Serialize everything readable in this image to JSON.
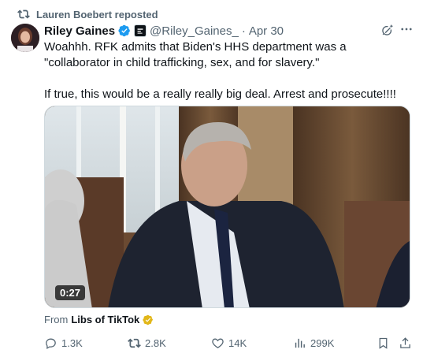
{
  "repost": {
    "label": "Lauren Boebert reposted"
  },
  "author": {
    "name": "Riley Gaines",
    "handle": "@Riley_Gaines_",
    "separator": "·",
    "date": "Apr 30"
  },
  "tweet": {
    "line1": "Woahhh. RFK admits that Biden's HHS department was a \"collaborator in child trafficking, sex, and for slavery.\"",
    "line2": "If true, this would be a really really big deal. Arrest and prosecute!!!!"
  },
  "video": {
    "duration": "0:27"
  },
  "attribution": {
    "prefix": "From",
    "source": "Libs of TikTok"
  },
  "actions": {
    "replies": "1.3K",
    "reposts": "2.8K",
    "likes": "14K",
    "views": "299K"
  },
  "colors": {
    "verified": "#1d9bf0",
    "muted": "#536471",
    "gold": "#e2b719"
  },
  "icons": [
    "repost-icon",
    "verified-badge-icon",
    "affiliation-icon",
    "grok-icon",
    "more-icon",
    "reply-icon",
    "like-icon",
    "views-icon",
    "bookmark-icon",
    "share-icon"
  ]
}
